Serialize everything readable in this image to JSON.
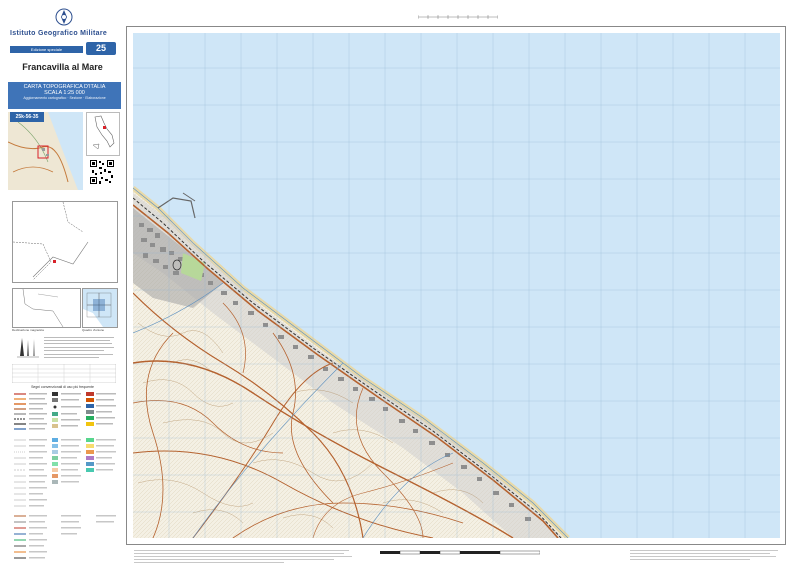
{
  "header": {
    "agency": "Istituto Geografico Militare",
    "edition": "Edizione speciale",
    "sheet_badge": "25",
    "sheet_name": "Francavilla al Mare",
    "series_line1": "CARTA TOPOGRAFICA D'ITALIA",
    "series_line2": "SCALA 1:25 000",
    "series_line3": "Aggiornamento cartografico · Sezione · Elaborazione",
    "sheet_id": "25k-56-35"
  },
  "captions": {
    "declination": "Declinazione magnetica",
    "grid": "Quadro d'unione"
  },
  "legend": {
    "title": "Segni convenzionali di uso più frequente"
  },
  "colors": {
    "sea": "#cfe6f7",
    "land": "#f4f0e4",
    "road": "#b5622f",
    "urban": "#8e8e8e",
    "brand_blue": "#2e64a8"
  }
}
